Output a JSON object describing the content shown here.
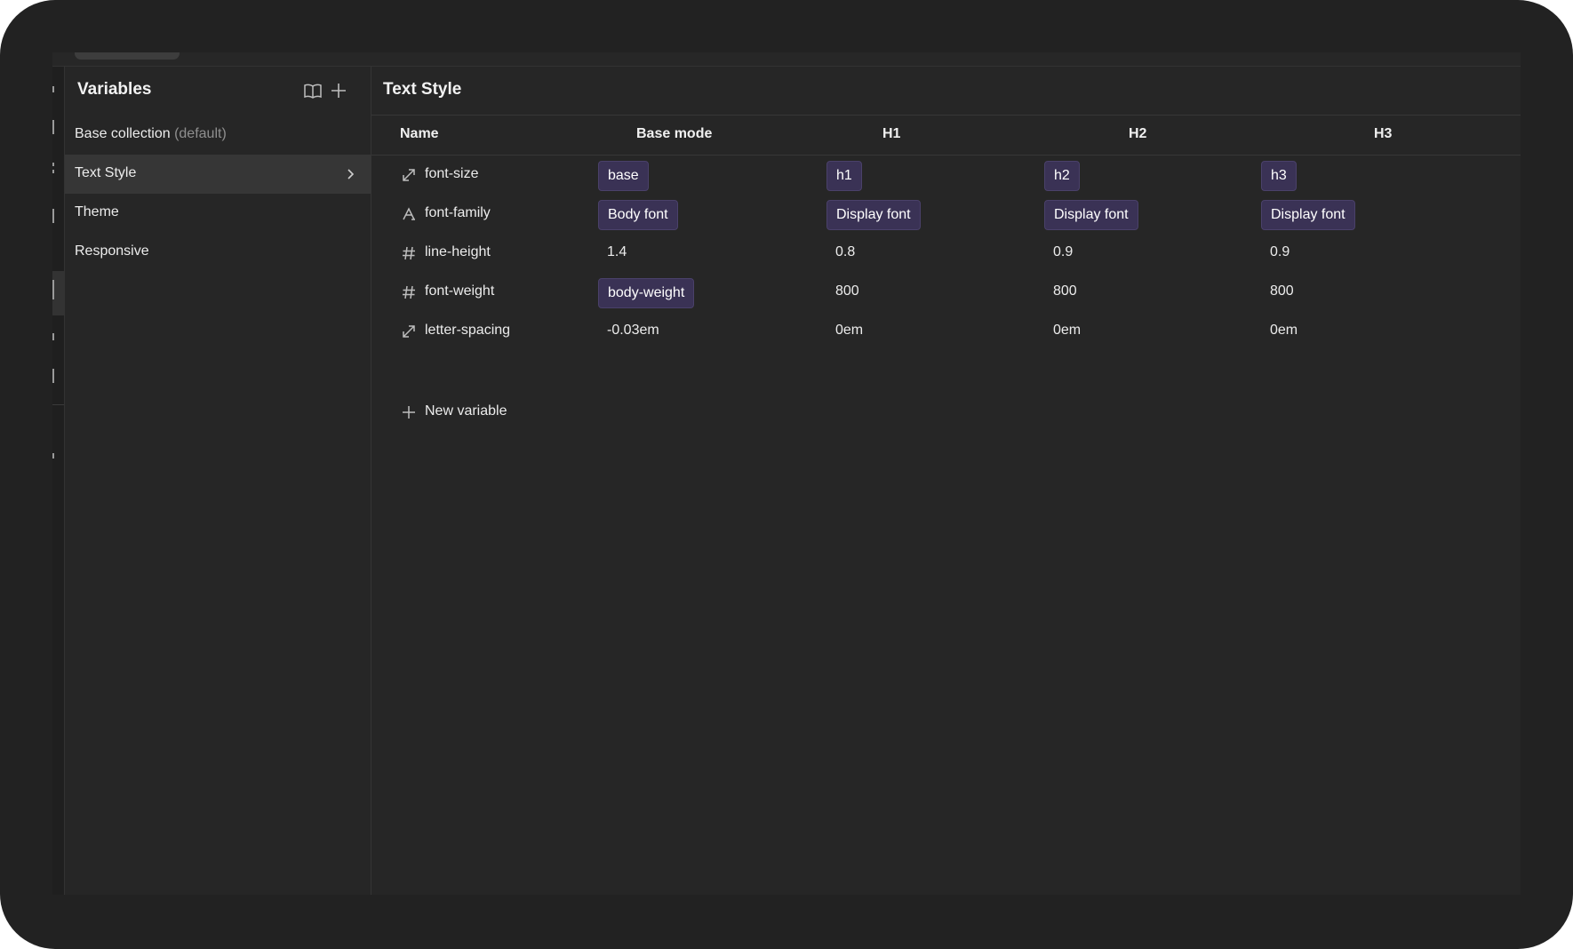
{
  "sidebar": {
    "title": "Variables",
    "icons": {
      "docs": "book-icon",
      "add": "plus-icon"
    },
    "collections": [
      {
        "label": "Base collection",
        "suffix": "(default)"
      },
      {
        "label": "Text Style"
      },
      {
        "label": "Theme"
      },
      {
        "label": "Responsive"
      }
    ],
    "selected_index": 1
  },
  "main": {
    "title": "Text Style",
    "columns": [
      "Name",
      "Base mode",
      "H1",
      "H2",
      "H3"
    ],
    "rows": [
      {
        "icon": "resize-diagonal-icon",
        "name": "font-size",
        "values": [
          {
            "text": "base",
            "chip": true
          },
          {
            "text": "h1",
            "chip": true
          },
          {
            "text": "h2",
            "chip": true
          },
          {
            "text": "h3",
            "chip": true
          }
        ]
      },
      {
        "icon": "font-icon",
        "name": "font-family",
        "values": [
          {
            "text": "Body font",
            "chip": true
          },
          {
            "text": "Display font",
            "chip": true
          },
          {
            "text": "Display font",
            "chip": true
          },
          {
            "text": "Display font",
            "chip": true
          }
        ]
      },
      {
        "icon": "hash-icon",
        "name": "line-height",
        "values": [
          {
            "text": "1.4",
            "chip": false
          },
          {
            "text": "0.8",
            "chip": false
          },
          {
            "text": "0.9",
            "chip": false
          },
          {
            "text": "0.9",
            "chip": false
          }
        ]
      },
      {
        "icon": "hash-icon",
        "name": "font-weight",
        "values": [
          {
            "text": "body-weight",
            "chip": true
          },
          {
            "text": "800",
            "chip": false
          },
          {
            "text": "800",
            "chip": false
          },
          {
            "text": "800",
            "chip": false
          }
        ]
      },
      {
        "icon": "resize-diagonal-icon",
        "name": "letter-spacing",
        "values": [
          {
            "text": "-0.03em",
            "chip": false
          },
          {
            "text": "0em",
            "chip": false
          },
          {
            "text": "0em",
            "chip": false
          },
          {
            "text": "0em",
            "chip": false
          }
        ]
      }
    ],
    "new_variable_label": "New variable"
  },
  "colors": {
    "background": "#262626",
    "chip_bg": "#3a3255",
    "selected_row": "#363636",
    "text": "#ececec",
    "muted": "#8f8f8f"
  }
}
